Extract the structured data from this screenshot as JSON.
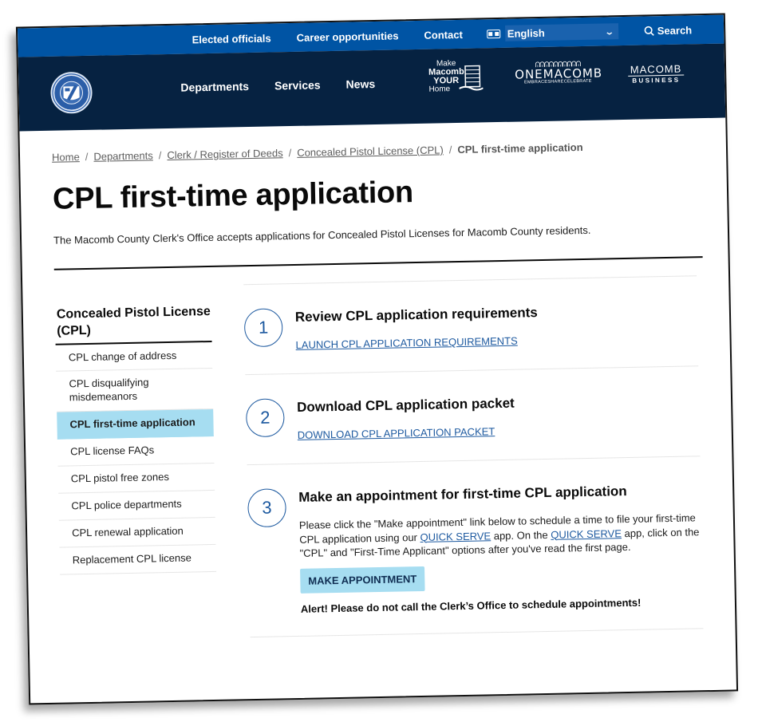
{
  "utility_nav": {
    "links": [
      "Elected officials",
      "Career opportunities",
      "Contact"
    ],
    "language": {
      "icon": "translate-icon",
      "selected": "English"
    },
    "search_label": "Search"
  },
  "header": {
    "logo_alt": "Macomb County Michigan seal",
    "nav": [
      "Departments",
      "Services",
      "News"
    ],
    "partners": {
      "make_macomb": {
        "line1": "Make",
        "line2": "Macomb",
        "line3": "YOUR",
        "line4": "Home"
      },
      "one_macomb": {
        "people": "ᕬᕬᕬᕬᕬᕬᕬᕬᕬᕬ",
        "name": "ONEMACOMB",
        "tagline": "EMBRACESHARECELEBRATE"
      },
      "macomb_business": {
        "name": "MACOMB",
        "tagline": "BUSINESS"
      }
    }
  },
  "breadcrumb": {
    "links": [
      "Home",
      "Departments",
      "Clerk / Register of Deeds",
      "Concealed Pistol License (CPL)"
    ],
    "current": "CPL first-time application"
  },
  "page": {
    "title": "CPL first-time application",
    "intro": "The Macomb County Clerk's Office accepts applications for Concealed Pistol Licenses for Macomb County residents."
  },
  "sidebar": {
    "title": "Concealed Pistol License (CPL)",
    "items": [
      {
        "label": "CPL change of address",
        "active": false
      },
      {
        "label": "CPL disqualifying misdemeanors",
        "active": false
      },
      {
        "label": "CPL first-time application",
        "active": true
      },
      {
        "label": "CPL license FAQs",
        "active": false
      },
      {
        "label": "CPL pistol free zones",
        "active": false
      },
      {
        "label": "CPL police departments",
        "active": false
      },
      {
        "label": "CPL renewal application",
        "active": false
      },
      {
        "label": "Replacement CPL license",
        "active": false
      }
    ]
  },
  "steps": [
    {
      "number": "1",
      "title": "Review CPL application requirements",
      "link": "LAUNCH CPL APPLICATION REQUIREMENTS"
    },
    {
      "number": "2",
      "title": "Download CPL application packet",
      "link": "DOWNLOAD CPL APPLICATION PACKET"
    },
    {
      "number": "3",
      "title": "Make an appointment for first-time CPL application",
      "text_part1": "Please click the \"Make appointment\" link below to schedule a time to file your first-time CPL application using our ",
      "link1": "QUICK SERVE",
      "text_part2": " app.  On the ",
      "link2": "QUICK SERVE",
      "text_part3": " app, click on the \"CPL\" and \"First-Time Applicant\" options after you've read the first page.",
      "button": "MAKE APPOINTMENT",
      "alert": "Alert! Please do not call the Clerk’s Office to schedule appointments!"
    }
  ],
  "colors": {
    "utility_bar": "#0054a4",
    "header": "#062241",
    "link": "#1e5aa0",
    "active_highlight": "#a6ddf1"
  }
}
